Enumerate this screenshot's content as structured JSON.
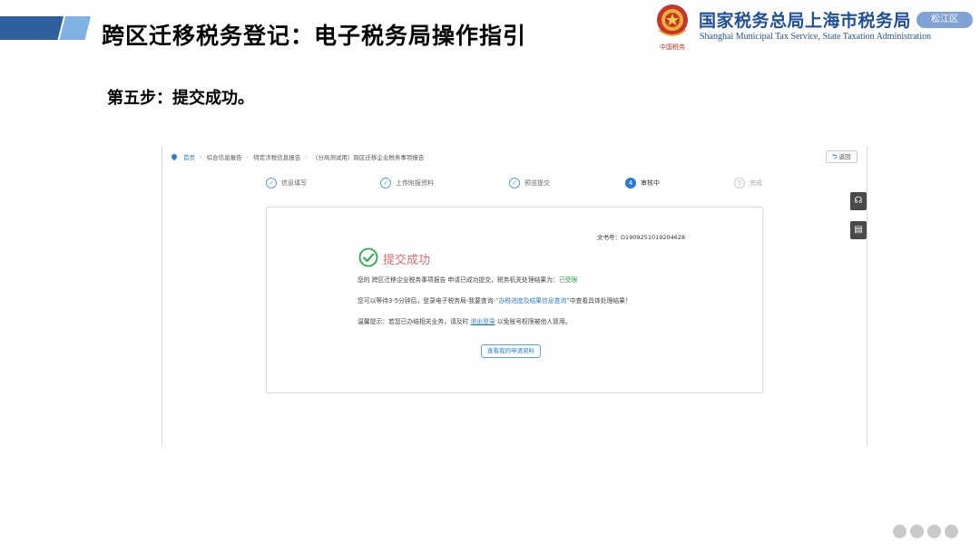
{
  "slide": {
    "title": "跨区迁移税务登记：电子税务局操作指引",
    "step_heading": "第五步：提交成功。",
    "brand_cn": "国家税务总局上海市税务局",
    "brand_en": "Shanghai Municipal Tax Service, State Taxation Administration",
    "district": "松江区",
    "accent_dark": "#2f5f9e",
    "accent_light": "#7fb2e2",
    "brand_color": "#1f4f9a"
  },
  "portal": {
    "breadcrumb": [
      "首页",
      "综合信息报告",
      "特定涉税信息报告",
      "（分局测试用）跨区迁移企业税务事项报告"
    ],
    "back_label": "返回",
    "steps": [
      {
        "label": "信息填写",
        "state": "done",
        "mark": "✓"
      },
      {
        "label": "上传附报资料",
        "state": "done",
        "mark": "✓"
      },
      {
        "label": "预览提交",
        "state": "done",
        "mark": "✓"
      },
      {
        "label": "审核中",
        "state": "current",
        "mark": "4"
      },
      {
        "label": "完成",
        "state": "todo",
        "mark": "5"
      }
    ],
    "card": {
      "doc_no": "文书号：D1909251019204628",
      "success_title": "提交成功",
      "line1_pre": "您的 跨区迁移企业税务事项报告 申请已成功提交，税务机关处理结果为：",
      "line1_status": "已受理",
      "line2_pre": "您可以等待3-5分钟后，登录电子税务局-我要查询-",
      "line2_link": "“办税进度及结果信息查询”",
      "line2_post": "中查看具体处理结果！",
      "line3_pre": "温馨提示：若您已办结相关业务，请及时",
      "line3_link": "退出登录",
      "line3_post": "以免账号权限被他人冒用。",
      "view_button": "查看我的申请资料"
    },
    "side_tools": [
      "headset-icon",
      "document-icon"
    ]
  }
}
